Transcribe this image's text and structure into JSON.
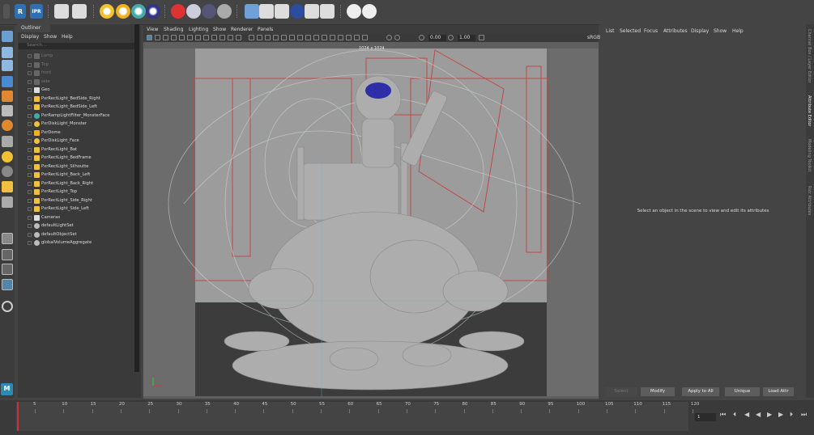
{
  "outliner": {
    "tab": "Outliner",
    "menus": [
      "Display",
      "Show",
      "Help"
    ],
    "search_placeholder": "Search...",
    "items": [
      {
        "label": "Lamp",
        "icon": "camera-icon",
        "dim": true
      },
      {
        "label": "Top",
        "icon": "camera-icon",
        "dim": true
      },
      {
        "label": "front",
        "icon": "camera-icon",
        "dim": true
      },
      {
        "label": "side",
        "icon": "camera-icon",
        "dim": true
      },
      {
        "label": "Geo",
        "icon": "group-icon",
        "dim": false
      },
      {
        "label": "PxrRectLight_BedSide_Right",
        "icon": "rect-light-icon",
        "dim": false
      },
      {
        "label": "PxrRectLight_BedSide_Left",
        "icon": "rect-light-icon",
        "dim": false
      },
      {
        "label": "PxrRampLightFilter_MonsterFace",
        "icon": "light-filter-icon",
        "dim": false
      },
      {
        "label": "PxrDiskLight_Monster",
        "icon": "disk-light-icon",
        "dim": false
      },
      {
        "label": "PxrDome",
        "icon": "dome-light-icon",
        "dim": false
      },
      {
        "label": "PxrDiskLight_Face",
        "icon": "disk-light-icon",
        "dim": false
      },
      {
        "label": "PxrRectLight_Bat",
        "icon": "rect-light-icon",
        "dim": false
      },
      {
        "label": "PxrRectLight_BedFrame",
        "icon": "rect-light-icon",
        "dim": false
      },
      {
        "label": "PxrRectLight_Silhoutte",
        "icon": "rect-light-icon",
        "dim": false
      },
      {
        "label": "PxrRectLight_Back_Left",
        "icon": "rect-light-icon",
        "dim": false
      },
      {
        "label": "PxrRectLight_Back_Right",
        "icon": "rect-light-icon",
        "dim": false
      },
      {
        "label": "PxrRectLight_Top",
        "icon": "rect-light-icon",
        "dim": false
      },
      {
        "label": "PxrRectLight_Side_Right",
        "icon": "rect-light-icon",
        "dim": false
      },
      {
        "label": "PxrRectLight_Side_Left",
        "icon": "rect-light-icon",
        "dim": false
      },
      {
        "label": "Cameras",
        "icon": "group-icon",
        "dim": false
      },
      {
        "label": "defaultLightSet",
        "icon": "set-icon",
        "dim": false
      },
      {
        "label": "defaultObjectSet",
        "icon": "set-icon",
        "dim": false
      },
      {
        "label": "globalVolumeAggregate",
        "icon": "volume-icon",
        "dim": false
      }
    ]
  },
  "viewport": {
    "menus": [
      "View",
      "Shading",
      "Lighting",
      "Show",
      "Renderer",
      "Panels"
    ],
    "resolution": "1024 x 1024",
    "exposure": "0.00",
    "gamma": "1.00",
    "colorspace": "sRGB"
  },
  "attribute_editor": {
    "menus": [
      "List",
      "Selected",
      "Focus",
      "Attributes",
      "Display",
      "Show",
      "Help"
    ],
    "message": "Select an object in the scene to view and edit its attributes",
    "buttons": [
      "Select",
      "Modify",
      "Apply to All",
      "Unique",
      "Load Attr"
    ]
  },
  "side_tabs": [
    "Channel Box / Layer Editor",
    "Attribute Editor",
    "Modeling Toolkit",
    "Rstr Attributes"
  ],
  "shelf": {
    "label_r": "R",
    "label_ipr": "IPR"
  },
  "timeline": {
    "ticks": [
      "5",
      "10",
      "15",
      "20",
      "25",
      "30",
      "35",
      "40",
      "45",
      "50",
      "55",
      "60",
      "65",
      "70",
      "75",
      "80",
      "85",
      "90",
      "95",
      "100",
      "105",
      "110",
      "115",
      "120"
    ],
    "current_frame": "1"
  },
  "colors": {
    "rect_light": "#f0c040",
    "selection_red": "#cc2020",
    "accent_blue": "#5285a6"
  }
}
